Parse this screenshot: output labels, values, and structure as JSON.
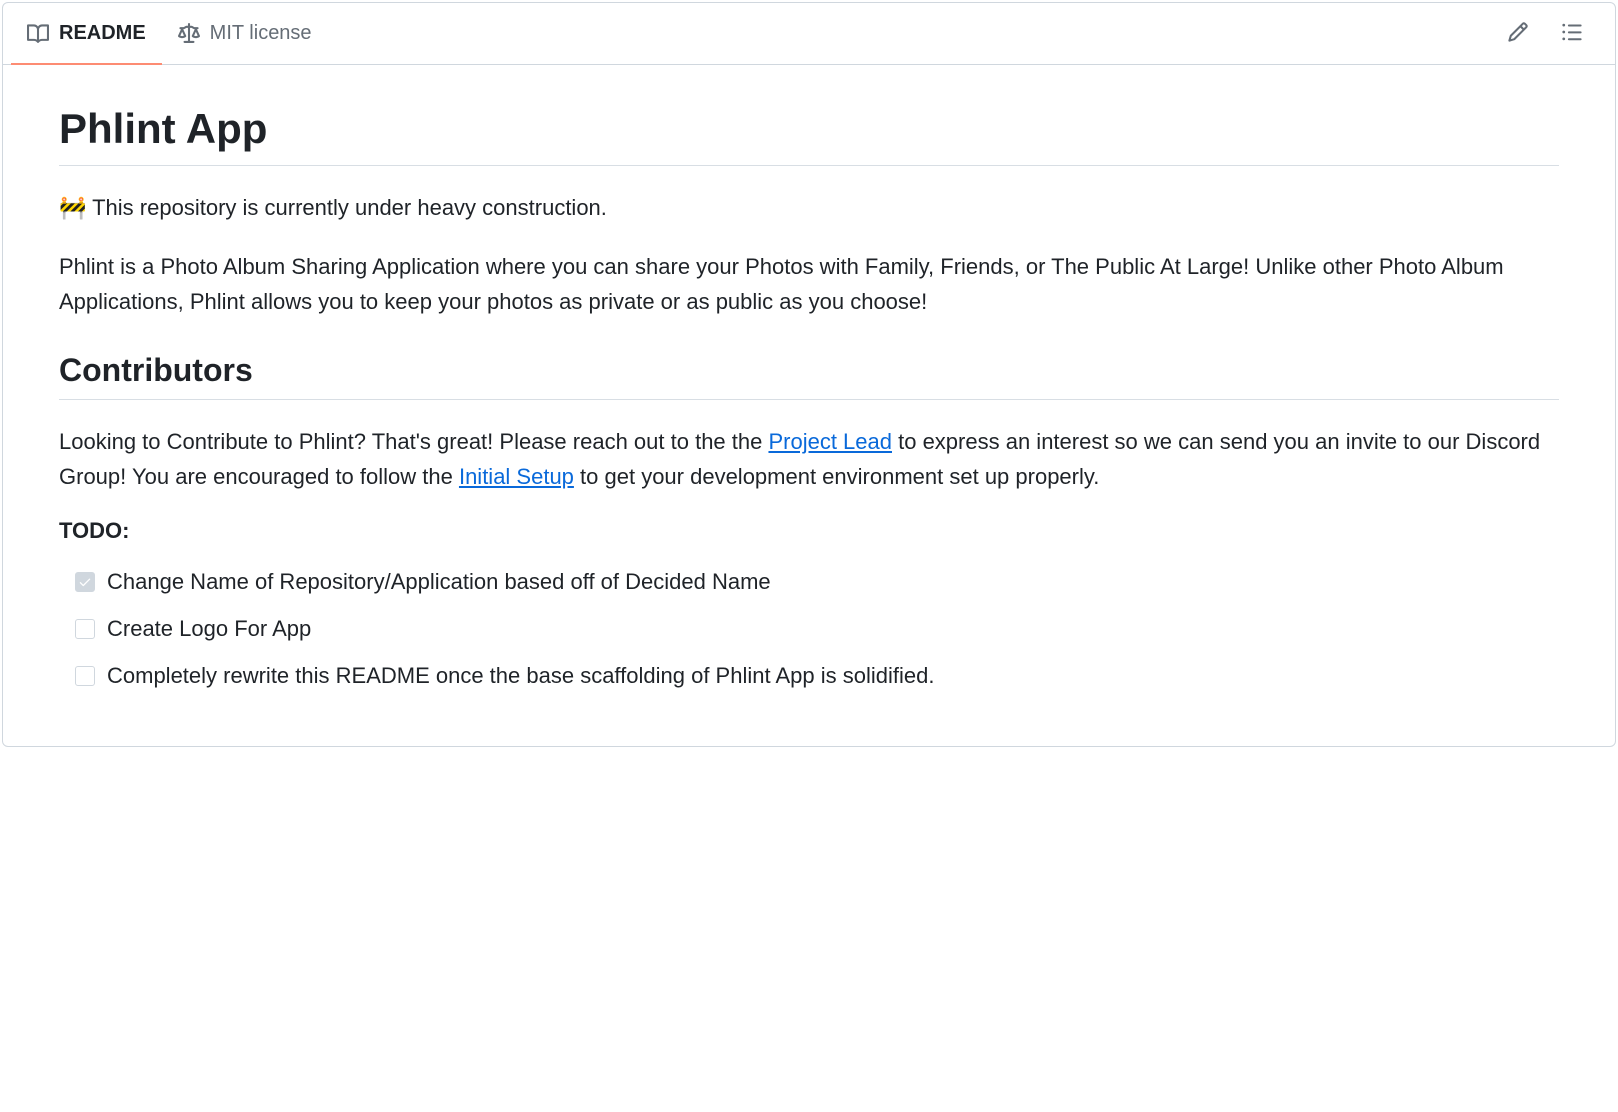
{
  "tabs": {
    "readme": "README",
    "license": "MIT license"
  },
  "readme": {
    "title": "Phlint App",
    "construction_emoji": "🚧",
    "construction_text": " This repository is currently under heavy construction.",
    "description": "Phlint is a Photo Album Sharing Application where you can share your Photos with Family, Friends, or The Public At Large! Unlike other Photo Album Applications, Phlint allows you to keep your photos as private or as public as you choose!",
    "contributors_heading": "Contributors",
    "contributors_text_1": "Looking to Contribute to Phlint? That's great! Please reach out to the the ",
    "contributors_link_1": "Project Lead",
    "contributors_text_2": " to express an interest so we can send you an invite to our Discord Group! You are encouraged to follow the ",
    "contributors_link_2": "Initial Setup",
    "contributors_text_3": " to get your development environment set up properly.",
    "todo_heading": "TODO:",
    "tasks": [
      {
        "done": true,
        "text": "Change Name of Repository/Application based off of Decided Name"
      },
      {
        "done": false,
        "text": "Create Logo For App"
      },
      {
        "done": false,
        "text": "Completely rewrite this README once the base scaffolding of Phlint App is solidified."
      }
    ]
  }
}
